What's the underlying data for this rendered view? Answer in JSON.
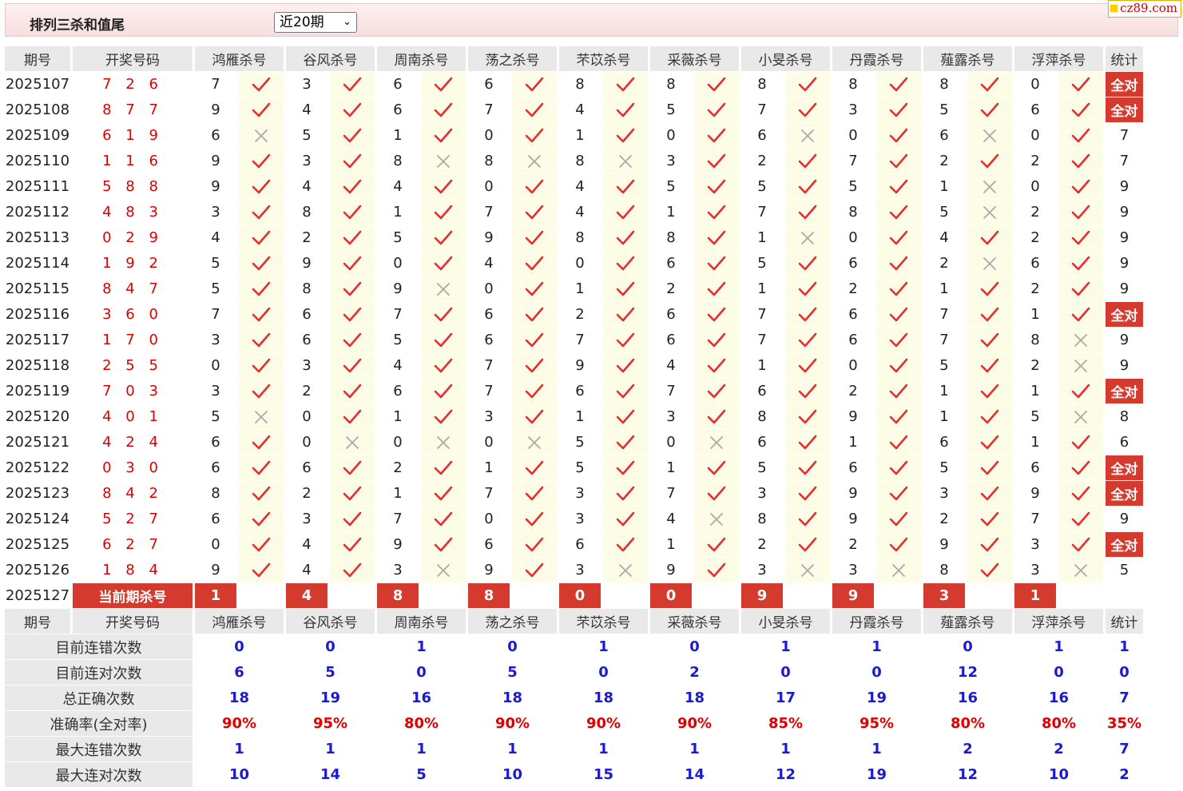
{
  "header": {
    "title": "排列三杀和值尾",
    "period_select": "近20期",
    "site_badge": "cz89.com"
  },
  "columns": {
    "qihao": "期号",
    "kaijiang": "开奖号码",
    "stat": "统计"
  },
  "experts": [
    "鸿雁杀号",
    "谷风杀号",
    "周南杀号",
    "荡之杀号",
    "芣苡杀号",
    "采薇杀号",
    "小旻杀号",
    "丹霞杀号",
    "薤露杀号",
    "浮萍杀号"
  ],
  "rows": [
    {
      "q": "2025107",
      "n": "7 2 6",
      "k": [
        [
          7,
          1
        ],
        [
          3,
          1
        ],
        [
          6,
          1
        ],
        [
          6,
          1
        ],
        [
          8,
          1
        ],
        [
          8,
          1
        ],
        [
          8,
          1
        ],
        [
          8,
          1
        ],
        [
          8,
          1
        ],
        [
          0,
          1
        ]
      ],
      "s": "全对"
    },
    {
      "q": "2025108",
      "n": "8 7 7",
      "k": [
        [
          9,
          1
        ],
        [
          4,
          1
        ],
        [
          6,
          1
        ],
        [
          7,
          1
        ],
        [
          4,
          1
        ],
        [
          5,
          1
        ],
        [
          7,
          1
        ],
        [
          3,
          1
        ],
        [
          5,
          1
        ],
        [
          6,
          1
        ]
      ],
      "s": "全对"
    },
    {
      "q": "2025109",
      "n": "6 1 9",
      "k": [
        [
          6,
          0
        ],
        [
          5,
          1
        ],
        [
          1,
          1
        ],
        [
          0,
          1
        ],
        [
          1,
          1
        ],
        [
          0,
          1
        ],
        [
          6,
          0
        ],
        [
          0,
          1
        ],
        [
          6,
          0
        ],
        [
          0,
          1
        ]
      ],
      "s": "7"
    },
    {
      "q": "2025110",
      "n": "1 1 6",
      "k": [
        [
          9,
          1
        ],
        [
          3,
          1
        ],
        [
          8,
          0
        ],
        [
          8,
          0
        ],
        [
          8,
          0
        ],
        [
          3,
          1
        ],
        [
          2,
          1
        ],
        [
          7,
          1
        ],
        [
          2,
          1
        ],
        [
          2,
          1
        ]
      ],
      "s": "7"
    },
    {
      "q": "2025111",
      "n": "5 8 8",
      "k": [
        [
          9,
          1
        ],
        [
          4,
          1
        ],
        [
          4,
          1
        ],
        [
          0,
          1
        ],
        [
          4,
          1
        ],
        [
          5,
          1
        ],
        [
          5,
          1
        ],
        [
          5,
          1
        ],
        [
          1,
          0
        ],
        [
          0,
          1
        ]
      ],
      "s": "9"
    },
    {
      "q": "2025112",
      "n": "4 8 3",
      "k": [
        [
          3,
          1
        ],
        [
          8,
          1
        ],
        [
          1,
          1
        ],
        [
          7,
          1
        ],
        [
          4,
          1
        ],
        [
          1,
          1
        ],
        [
          7,
          1
        ],
        [
          8,
          1
        ],
        [
          5,
          0
        ],
        [
          2,
          1
        ]
      ],
      "s": "9"
    },
    {
      "q": "2025113",
      "n": "0 2 9",
      "k": [
        [
          4,
          1
        ],
        [
          2,
          1
        ],
        [
          5,
          1
        ],
        [
          9,
          1
        ],
        [
          8,
          1
        ],
        [
          8,
          1
        ],
        [
          1,
          0
        ],
        [
          0,
          1
        ],
        [
          4,
          1
        ],
        [
          2,
          1
        ]
      ],
      "s": "9"
    },
    {
      "q": "2025114",
      "n": "1 9 2",
      "k": [
        [
          5,
          1
        ],
        [
          9,
          1
        ],
        [
          0,
          1
        ],
        [
          4,
          1
        ],
        [
          0,
          1
        ],
        [
          6,
          1
        ],
        [
          5,
          1
        ],
        [
          6,
          1
        ],
        [
          2,
          0
        ],
        [
          6,
          1
        ]
      ],
      "s": "9"
    },
    {
      "q": "2025115",
      "n": "8 4 7",
      "k": [
        [
          5,
          1
        ],
        [
          8,
          1
        ],
        [
          9,
          0
        ],
        [
          0,
          1
        ],
        [
          1,
          1
        ],
        [
          2,
          1
        ],
        [
          1,
          1
        ],
        [
          2,
          1
        ],
        [
          1,
          1
        ],
        [
          2,
          1
        ]
      ],
      "s": "9"
    },
    {
      "q": "2025116",
      "n": "3 6 0",
      "k": [
        [
          7,
          1
        ],
        [
          6,
          1
        ],
        [
          7,
          1
        ],
        [
          6,
          1
        ],
        [
          2,
          1
        ],
        [
          6,
          1
        ],
        [
          7,
          1
        ],
        [
          6,
          1
        ],
        [
          7,
          1
        ],
        [
          1,
          1
        ]
      ],
      "s": "全对"
    },
    {
      "q": "2025117",
      "n": "1 7 0",
      "k": [
        [
          3,
          1
        ],
        [
          6,
          1
        ],
        [
          5,
          1
        ],
        [
          6,
          1
        ],
        [
          7,
          1
        ],
        [
          6,
          1
        ],
        [
          7,
          1
        ],
        [
          6,
          1
        ],
        [
          7,
          1
        ],
        [
          8,
          0
        ]
      ],
      "s": "9"
    },
    {
      "q": "2025118",
      "n": "2 5 5",
      "k": [
        [
          0,
          1
        ],
        [
          3,
          1
        ],
        [
          4,
          1
        ],
        [
          7,
          1
        ],
        [
          9,
          1
        ],
        [
          4,
          1
        ],
        [
          1,
          1
        ],
        [
          0,
          1
        ],
        [
          5,
          1
        ],
        [
          2,
          0
        ]
      ],
      "s": "9"
    },
    {
      "q": "2025119",
      "n": "7 0 3",
      "k": [
        [
          3,
          1
        ],
        [
          2,
          1
        ],
        [
          6,
          1
        ],
        [
          7,
          1
        ],
        [
          6,
          1
        ],
        [
          7,
          1
        ],
        [
          6,
          1
        ],
        [
          2,
          1
        ],
        [
          1,
          1
        ],
        [
          1,
          1
        ]
      ],
      "s": "全对"
    },
    {
      "q": "2025120",
      "n": "4 0 1",
      "k": [
        [
          5,
          0
        ],
        [
          0,
          1
        ],
        [
          1,
          1
        ],
        [
          3,
          1
        ],
        [
          1,
          1
        ],
        [
          3,
          1
        ],
        [
          8,
          1
        ],
        [
          9,
          1
        ],
        [
          1,
          1
        ],
        [
          5,
          0
        ]
      ],
      "s": "8"
    },
    {
      "q": "2025121",
      "n": "4 2 4",
      "k": [
        [
          6,
          1
        ],
        [
          0,
          0
        ],
        [
          0,
          0
        ],
        [
          0,
          0
        ],
        [
          5,
          1
        ],
        [
          0,
          0
        ],
        [
          6,
          1
        ],
        [
          1,
          1
        ],
        [
          6,
          1
        ],
        [
          1,
          1
        ]
      ],
      "s": "6"
    },
    {
      "q": "2025122",
      "n": "0 3 0",
      "k": [
        [
          6,
          1
        ],
        [
          6,
          1
        ],
        [
          2,
          1
        ],
        [
          1,
          1
        ],
        [
          5,
          1
        ],
        [
          1,
          1
        ],
        [
          5,
          1
        ],
        [
          6,
          1
        ],
        [
          5,
          1
        ],
        [
          6,
          1
        ]
      ],
      "s": "全对"
    },
    {
      "q": "2025123",
      "n": "8 4 2",
      "k": [
        [
          8,
          1
        ],
        [
          2,
          1
        ],
        [
          1,
          1
        ],
        [
          7,
          1
        ],
        [
          3,
          1
        ],
        [
          7,
          1
        ],
        [
          3,
          1
        ],
        [
          9,
          1
        ],
        [
          3,
          1
        ],
        [
          9,
          1
        ]
      ],
      "s": "全对"
    },
    {
      "q": "2025124",
      "n": "5 2 7",
      "k": [
        [
          6,
          1
        ],
        [
          3,
          1
        ],
        [
          7,
          1
        ],
        [
          0,
          1
        ],
        [
          3,
          1
        ],
        [
          4,
          0
        ],
        [
          8,
          1
        ],
        [
          9,
          1
        ],
        [
          2,
          1
        ],
        [
          7,
          1
        ]
      ],
      "s": "9"
    },
    {
      "q": "2025125",
      "n": "6 2 7",
      "k": [
        [
          0,
          1
        ],
        [
          4,
          1
        ],
        [
          9,
          1
        ],
        [
          6,
          1
        ],
        [
          6,
          1
        ],
        [
          1,
          1
        ],
        [
          2,
          1
        ],
        [
          2,
          1
        ],
        [
          9,
          1
        ],
        [
          3,
          1
        ]
      ],
      "s": "全对"
    },
    {
      "q": "2025126",
      "n": "1 8 4",
      "k": [
        [
          9,
          1
        ],
        [
          4,
          1
        ],
        [
          3,
          0
        ],
        [
          9,
          1
        ],
        [
          3,
          0
        ],
        [
          9,
          1
        ],
        [
          3,
          0
        ],
        [
          3,
          0
        ],
        [
          8,
          1
        ],
        [
          3,
          0
        ]
      ],
      "s": "5"
    }
  ],
  "current": {
    "q": "2025127",
    "label": "当前期杀号",
    "kills": [
      "1",
      "4",
      "8",
      "8",
      "0",
      "0",
      "9",
      "9",
      "3",
      "1"
    ]
  },
  "summary": [
    {
      "label": "目前连错次数",
      "vals": [
        "0",
        "0",
        "1",
        "0",
        "1",
        "0",
        "1",
        "1",
        "0",
        "1"
      ],
      "stat": "1",
      "red": false
    },
    {
      "label": "目前连对次数",
      "vals": [
        "6",
        "5",
        "0",
        "5",
        "0",
        "2",
        "0",
        "0",
        "12",
        "0"
      ],
      "stat": "0",
      "red": false
    },
    {
      "label": "总正确次数",
      "vals": [
        "18",
        "19",
        "16",
        "18",
        "18",
        "18",
        "17",
        "19",
        "16",
        "16"
      ],
      "stat": "7",
      "red": false
    },
    {
      "label": "准确率(全对率)",
      "vals": [
        "90%",
        "95%",
        "80%",
        "90%",
        "90%",
        "90%",
        "85%",
        "95%",
        "80%",
        "80%"
      ],
      "stat": "35%",
      "red": true
    },
    {
      "label": "最大连错次数",
      "vals": [
        "1",
        "1",
        "1",
        "1",
        "1",
        "1",
        "1",
        "1",
        "2",
        "2"
      ],
      "stat": "7",
      "red": false
    },
    {
      "label": "最大连对次数",
      "vals": [
        "10",
        "14",
        "5",
        "10",
        "15",
        "14",
        "12",
        "19",
        "12",
        "10"
      ],
      "stat": "2",
      "red": false
    }
  ],
  "icons": {
    "right": "check-icon",
    "wrong": "cross-icon"
  },
  "colors": {
    "accent": "#d43a2e",
    "check": "#e03030",
    "cross": "#aaaaaa",
    "summary_blue": "#1a1ad0"
  }
}
